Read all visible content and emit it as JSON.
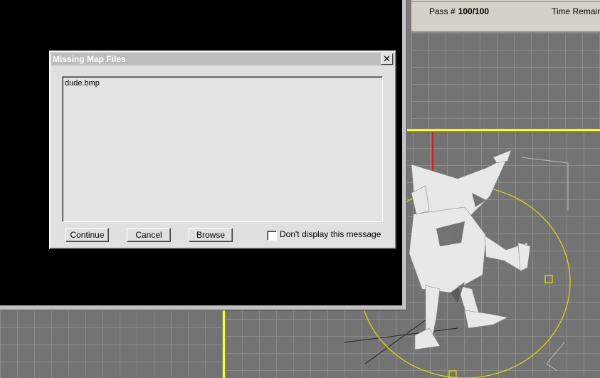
{
  "dialog": {
    "title": "Missing Map Files",
    "files": [
      "dude.bmp"
    ],
    "buttons": {
      "continue": "Continue",
      "cancel": "Cancel",
      "browse": "Browse"
    },
    "checkbox_label": "Don't display this message",
    "checkbox_checked": false,
    "close_glyph": "✕"
  },
  "progress_panel": {
    "pass_label": "Pass #",
    "pass_value": "100/100",
    "time_label": "Time Remainin"
  },
  "colors": {
    "selection": "#ffff00",
    "axis_red": "#ff0000",
    "viewport_bg": "#737373"
  },
  "icons": [
    "close-icon",
    "checkbox-icon"
  ]
}
